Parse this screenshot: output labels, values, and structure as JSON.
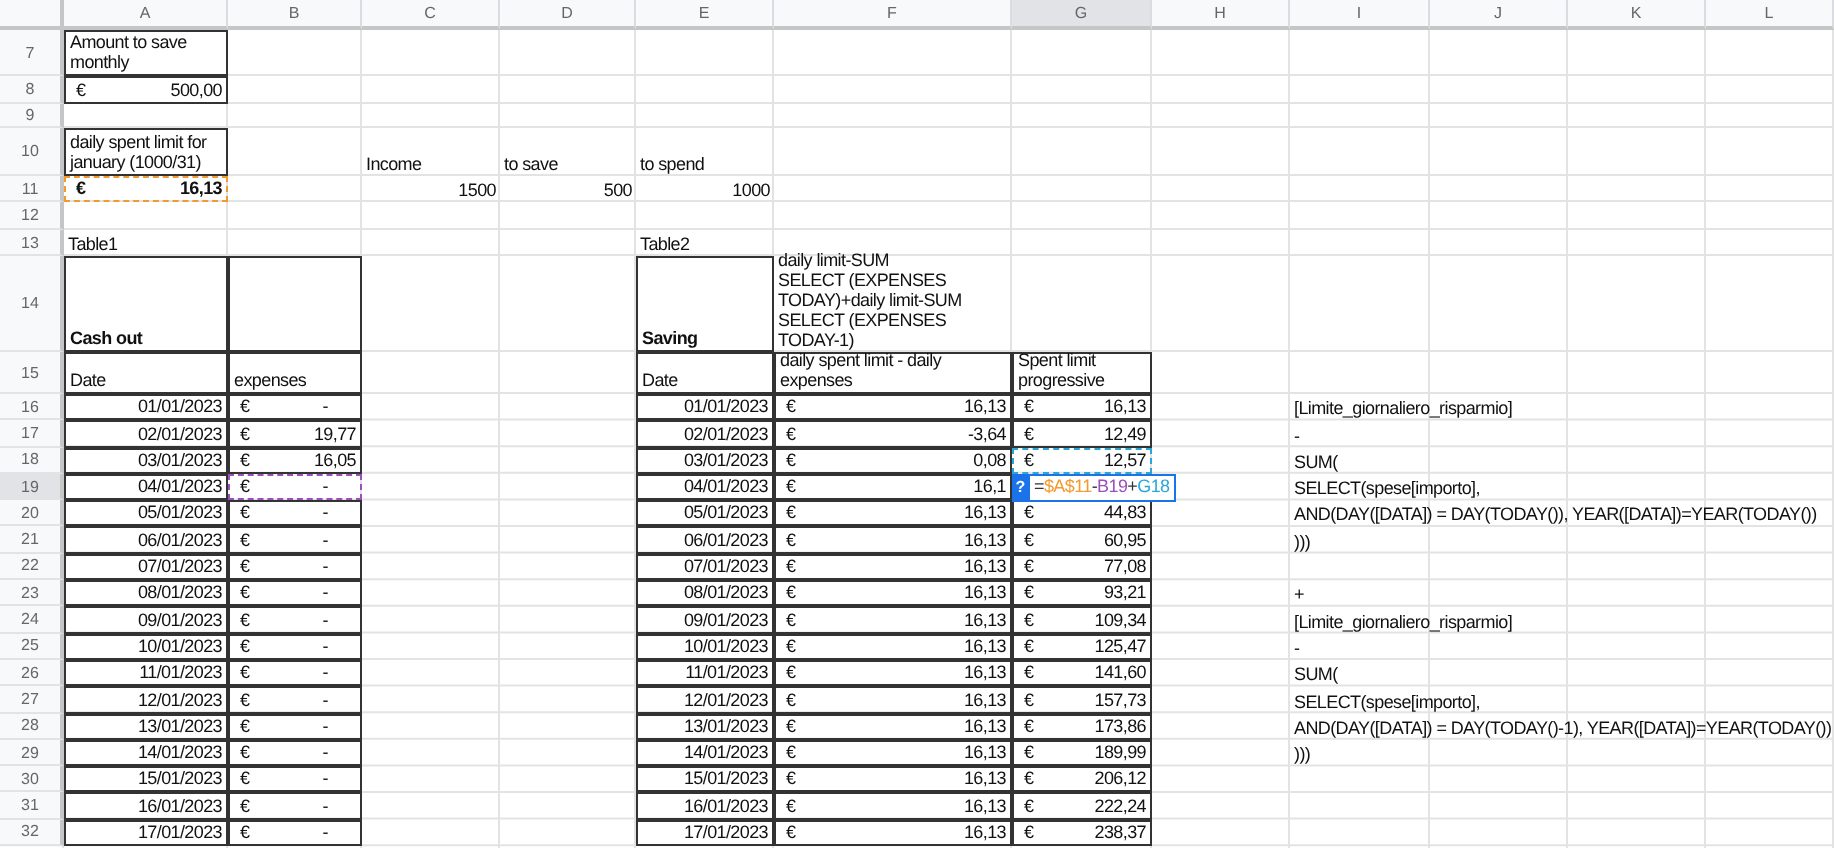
{
  "columns": [
    {
      "label": "A",
      "selected": false
    },
    {
      "label": "B",
      "selected": false
    },
    {
      "label": "C",
      "selected": false
    },
    {
      "label": "D",
      "selected": false
    },
    {
      "label": "E",
      "selected": false
    },
    {
      "label": "F",
      "selected": false
    },
    {
      "label": "G",
      "selected": true
    },
    {
      "label": "H",
      "selected": false
    },
    {
      "label": "I",
      "selected": false
    },
    {
      "label": "J",
      "selected": false
    },
    {
      "label": "K",
      "selected": false
    },
    {
      "label": "L",
      "selected": false
    }
  ],
  "rows": [
    {
      "number": "7",
      "selected": false,
      "cells": [
        {
          "kind": "text",
          "text": "Amount to save monthly",
          "wrap": true,
          "boxed": true
        }
      ]
    },
    {
      "number": "8",
      "selected": false,
      "cells": [
        {
          "kind": "currency",
          "symbol": "€",
          "text": "500,00",
          "boxed": true
        }
      ]
    },
    {
      "number": "9",
      "selected": false,
      "cells": []
    },
    {
      "number": "10",
      "selected": false,
      "cells": [
        {
          "kind": "text",
          "text": "daily spent limit for\njanuary (1000/31)",
          "wrap": true,
          "boxed": true
        },
        null,
        {
          "kind": "text",
          "text": "Income"
        },
        {
          "kind": "text",
          "text": "to save"
        },
        {
          "kind": "text",
          "text": "to spend"
        }
      ]
    },
    {
      "number": "11",
      "selected": false,
      "cells": [
        {
          "kind": "currency",
          "symbol": "€",
          "text": "16,13",
          "bold": true,
          "color": "#f29a2e"
        },
        null,
        {
          "kind": "number",
          "text": "1500"
        },
        {
          "kind": "number",
          "text": "500"
        },
        {
          "kind": "number",
          "text": "1000"
        }
      ]
    },
    {
      "number": "12",
      "selected": false,
      "cells": []
    },
    {
      "number": "13",
      "selected": false,
      "cells": [
        {
          "kind": "text",
          "text": "Table1"
        },
        null,
        null,
        null,
        {
          "kind": "text",
          "text": "Table2"
        }
      ]
    },
    {
      "number": "14",
      "selected": false,
      "cells": [
        {
          "kind": "text",
          "text": "Cash out",
          "bold": true,
          "boxed": true
        },
        {
          "boxed": true
        },
        null,
        null,
        {
          "kind": "text",
          "text": "Saving",
          "bold": true,
          "boxed": true
        },
        {
          "kind": "text",
          "text": "daily limit-SUM\nSELECT (EXPENSES\nTODAY)+daily limit-SUM\nSELECT (EXPENSES TODAY-1)",
          "wrap": true
        }
      ]
    },
    {
      "number": "15",
      "selected": false,
      "cells": [
        {
          "kind": "text",
          "text": "Date",
          "boxed": true
        },
        {
          "kind": "text",
          "text": "expenses",
          "boxed": true
        },
        null,
        null,
        {
          "kind": "text",
          "text": "Date",
          "boxed": true
        },
        {
          "kind": "text",
          "text": " daily spent limit - daily expenses",
          "wrap": true,
          "boxed": true
        },
        {
          "kind": "text",
          "text": "Spent limit progressive",
          "wrap": true,
          "boxed": true
        }
      ]
    },
    {
      "number": "16",
      "selected": false,
      "cells": [
        {
          "kind": "number",
          "text": "01/01/2023",
          "boxed": true
        },
        {
          "kind": "currency",
          "symbol": "€",
          "text": "-",
          "boxed": true
        },
        null,
        null,
        {
          "kind": "number",
          "text": "01/01/2023",
          "boxed": true
        },
        {
          "kind": "currency",
          "symbol": "€",
          "text": "16,13",
          "boxed": true
        },
        {
          "kind": "currency",
          "symbol": "€",
          "text": "16,13",
          "boxed": true
        },
        null,
        {
          "kind": "text",
          "text": "[Limite_giornaliero_risparmio]"
        }
      ]
    },
    {
      "number": "17",
      "selected": false,
      "cells": [
        {
          "kind": "number",
          "text": "02/01/2023",
          "boxed": true
        },
        {
          "kind": "currency",
          "symbol": "€",
          "text": "19,77",
          "boxed": true
        },
        null,
        null,
        {
          "kind": "number",
          "text": "02/01/2023",
          "boxed": true
        },
        {
          "kind": "currency",
          "symbol": "€",
          "text": "-3,64",
          "boxed": true
        },
        {
          "kind": "currency",
          "symbol": "€",
          "text": "12,49",
          "boxed": true
        },
        null,
        {
          "kind": "text",
          "text": "-"
        }
      ]
    },
    {
      "number": "18",
      "selected": false,
      "cells": [
        {
          "kind": "number",
          "text": "03/01/2023",
          "boxed": true
        },
        {
          "kind": "currency",
          "symbol": "€",
          "text": "16,05",
          "boxed": true
        },
        null,
        null,
        {
          "kind": "number",
          "text": "03/01/2023",
          "boxed": true
        },
        {
          "kind": "currency",
          "symbol": "€",
          "text": "0,08",
          "boxed": true
        },
        {
          "kind": "currency",
          "symbol": "€",
          "text": "12,57",
          "boxed": true,
          "color": "#2aa7d6"
        },
        null,
        {
          "kind": "text",
          "text": "SUM("
        }
      ]
    },
    {
      "number": "19",
      "selected": true,
      "cells": [
        {
          "kind": "number",
          "text": "04/01/2023",
          "boxed": true
        },
        {
          "kind": "currency",
          "symbol": "€",
          "text": "-",
          "color": "#9b4fbf"
        },
        null,
        null,
        {
          "kind": "number",
          "text": "04/01/2023",
          "boxed": true
        },
        {
          "kind": "currency",
          "symbol": "€",
          "text": "16,1",
          "boxed": true
        },
        {
          "kind": "editor",
          "boxed": true,
          "help": "?",
          "formula": [
            {
              "text": "="
            },
            {
              "text": "$A$11",
              "color": "#f29a2e"
            },
            {
              "text": "-"
            },
            {
              "text": "B19",
              "color": "#9b4fbf"
            },
            {
              "text": "+"
            },
            {
              "text": "G18",
              "color": "#2aa7d6"
            }
          ]
        },
        null,
        {
          "kind": "text",
          "text": "SELECT(spese[importo],"
        }
      ]
    },
    {
      "number": "20",
      "selected": false,
      "cells": [
        {
          "kind": "number",
          "text": "05/01/2023",
          "boxed": true
        },
        {
          "kind": "currency",
          "symbol": "€",
          "text": "-",
          "boxed": true
        },
        null,
        null,
        {
          "kind": "number",
          "text": "05/01/2023",
          "boxed": true
        },
        {
          "kind": "currency",
          "symbol": "€",
          "text": "16,13",
          "boxed": true
        },
        {
          "kind": "currency",
          "symbol": "€",
          "text": "44,83",
          "boxed": true
        },
        null,
        {
          "kind": "text",
          "text": "AND(DAY([DATA]) = DAY(TODAY()), YEAR([DATA])=YEAR(TODAY())"
        }
      ]
    },
    {
      "number": "21",
      "selected": false,
      "cells": [
        {
          "kind": "number",
          "text": "06/01/2023",
          "boxed": true
        },
        {
          "kind": "currency",
          "symbol": "€",
          "text": "-",
          "boxed": true
        },
        null,
        null,
        {
          "kind": "number",
          "text": "06/01/2023",
          "boxed": true
        },
        {
          "kind": "currency",
          "symbol": "€",
          "text": "16,13",
          "boxed": true
        },
        {
          "kind": "currency",
          "symbol": "€",
          "text": "60,95",
          "boxed": true
        },
        null,
        {
          "kind": "text",
          "text": ")))"
        }
      ]
    },
    {
      "number": "22",
      "selected": false,
      "cells": [
        {
          "kind": "number",
          "text": "07/01/2023",
          "boxed": true
        },
        {
          "kind": "currency",
          "symbol": "€",
          "text": "-",
          "boxed": true
        },
        null,
        null,
        {
          "kind": "number",
          "text": "07/01/2023",
          "boxed": true
        },
        {
          "kind": "currency",
          "symbol": "€",
          "text": "16,13",
          "boxed": true
        },
        {
          "kind": "currency",
          "symbol": "€",
          "text": "77,08",
          "boxed": true
        }
      ]
    },
    {
      "number": "23",
      "selected": false,
      "cells": [
        {
          "kind": "number",
          "text": "08/01/2023",
          "boxed": true
        },
        {
          "kind": "currency",
          "symbol": "€",
          "text": "-",
          "boxed": true
        },
        null,
        null,
        {
          "kind": "number",
          "text": "08/01/2023",
          "boxed": true
        },
        {
          "kind": "currency",
          "symbol": "€",
          "text": "16,13",
          "boxed": true
        },
        {
          "kind": "currency",
          "symbol": "€",
          "text": "93,21",
          "boxed": true
        },
        null,
        {
          "kind": "text",
          "text": "+"
        }
      ]
    },
    {
      "number": "24",
      "selected": false,
      "cells": [
        {
          "kind": "number",
          "text": "09/01/2023",
          "boxed": true
        },
        {
          "kind": "currency",
          "symbol": "€",
          "text": "-",
          "boxed": true
        },
        null,
        null,
        {
          "kind": "number",
          "text": "09/01/2023",
          "boxed": true
        },
        {
          "kind": "currency",
          "symbol": "€",
          "text": "16,13",
          "boxed": true
        },
        {
          "kind": "currency",
          "symbol": "€",
          "text": "109,34",
          "boxed": true
        },
        null,
        {
          "kind": "text",
          "text": "[Limite_giornaliero_risparmio]"
        }
      ]
    },
    {
      "number": "25",
      "selected": false,
      "cells": [
        {
          "kind": "number",
          "text": "10/01/2023",
          "boxed": true
        },
        {
          "kind": "currency",
          "symbol": "€",
          "text": "-",
          "boxed": true
        },
        null,
        null,
        {
          "kind": "number",
          "text": "10/01/2023",
          "boxed": true
        },
        {
          "kind": "currency",
          "symbol": "€",
          "text": "16,13",
          "boxed": true
        },
        {
          "kind": "currency",
          "symbol": "€",
          "text": "125,47",
          "boxed": true
        },
        null,
        {
          "kind": "text",
          "text": "-"
        }
      ]
    },
    {
      "number": "26",
      "selected": false,
      "cells": [
        {
          "kind": "number",
          "text": "11/01/2023",
          "boxed": true
        },
        {
          "kind": "currency",
          "symbol": "€",
          "text": "-",
          "boxed": true
        },
        null,
        null,
        {
          "kind": "number",
          "text": "11/01/2023",
          "boxed": true
        },
        {
          "kind": "currency",
          "symbol": "€",
          "text": "16,13",
          "boxed": true
        },
        {
          "kind": "currency",
          "symbol": "€",
          "text": "141,60",
          "boxed": true
        },
        null,
        {
          "kind": "text",
          "text": "SUM("
        }
      ]
    },
    {
      "number": "27",
      "selected": false,
      "cells": [
        {
          "kind": "number",
          "text": "12/01/2023",
          "boxed": true
        },
        {
          "kind": "currency",
          "symbol": "€",
          "text": "-",
          "boxed": true
        },
        null,
        null,
        {
          "kind": "number",
          "text": "12/01/2023",
          "boxed": true
        },
        {
          "kind": "currency",
          "symbol": "€",
          "text": "16,13",
          "boxed": true
        },
        {
          "kind": "currency",
          "symbol": "€",
          "text": "157,73",
          "boxed": true
        },
        null,
        {
          "kind": "text",
          "text": "SELECT(spese[importo],"
        }
      ]
    },
    {
      "number": "28",
      "selected": false,
      "cells": [
        {
          "kind": "number",
          "text": "13/01/2023",
          "boxed": true
        },
        {
          "kind": "currency",
          "symbol": "€",
          "text": "-",
          "boxed": true
        },
        null,
        null,
        {
          "kind": "number",
          "text": "13/01/2023",
          "boxed": true
        },
        {
          "kind": "currency",
          "symbol": "€",
          "text": "16,13",
          "boxed": true
        },
        {
          "kind": "currency",
          "symbol": "€",
          "text": "173,86",
          "boxed": true
        },
        null,
        {
          "kind": "text",
          "text": "AND(DAY([DATA]) = DAY(TODAY()-1), YEAR([DATA])=YEAR(TODAY())"
        }
      ]
    },
    {
      "number": "29",
      "selected": false,
      "cells": [
        {
          "kind": "number",
          "text": "14/01/2023",
          "boxed": true
        },
        {
          "kind": "currency",
          "symbol": "€",
          "text": "-",
          "boxed": true
        },
        null,
        null,
        {
          "kind": "number",
          "text": "14/01/2023",
          "boxed": true
        },
        {
          "kind": "currency",
          "symbol": "€",
          "text": "16,13",
          "boxed": true
        },
        {
          "kind": "currency",
          "symbol": "€",
          "text": "189,99",
          "boxed": true
        },
        null,
        {
          "kind": "text",
          "text": ")))"
        }
      ]
    },
    {
      "number": "30",
      "selected": false,
      "cells": [
        {
          "kind": "number",
          "text": "15/01/2023",
          "boxed": true
        },
        {
          "kind": "currency",
          "symbol": "€",
          "text": "-",
          "boxed": true
        },
        null,
        null,
        {
          "kind": "number",
          "text": "15/01/2023",
          "boxed": true
        },
        {
          "kind": "currency",
          "symbol": "€",
          "text": "16,13",
          "boxed": true
        },
        {
          "kind": "currency",
          "symbol": "€",
          "text": "206,12",
          "boxed": true
        }
      ]
    },
    {
      "number": "31",
      "selected": false,
      "cells": [
        {
          "kind": "number",
          "text": "16/01/2023",
          "boxed": true
        },
        {
          "kind": "currency",
          "symbol": "€",
          "text": "-",
          "boxed": true
        },
        null,
        null,
        {
          "kind": "number",
          "text": "16/01/2023",
          "boxed": true
        },
        {
          "kind": "currency",
          "symbol": "€",
          "text": "16,13",
          "boxed": true
        },
        {
          "kind": "currency",
          "symbol": "€",
          "text": "222,24",
          "boxed": true
        }
      ]
    },
    {
      "number": "32",
      "selected": false,
      "cells": [
        {
          "kind": "number",
          "text": "17/01/2023",
          "boxed": true
        },
        {
          "kind": "currency",
          "symbol": "€",
          "text": "-",
          "boxed": true
        },
        null,
        null,
        {
          "kind": "number",
          "text": "17/01/2023",
          "boxed": true
        },
        {
          "kind": "currency",
          "symbol": "€",
          "text": "16,13",
          "boxed": true
        },
        {
          "kind": "currency",
          "symbol": "€",
          "text": "238,37",
          "boxed": true
        }
      ]
    }
  ]
}
